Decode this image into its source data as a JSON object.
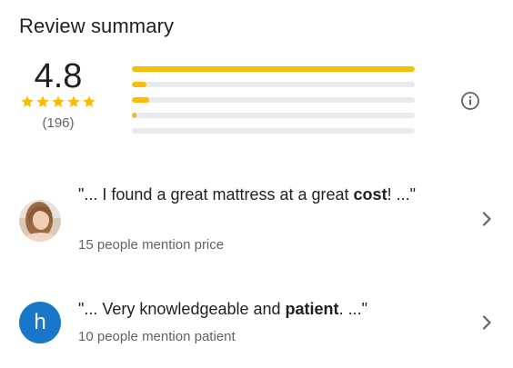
{
  "title": "Review summary",
  "rating": {
    "value": "4.8",
    "stars": 5,
    "count": "(196)"
  },
  "distribution": [
    {
      "stars": 5,
      "fraction": 1.0
    },
    {
      "stars": 4,
      "fraction": 0.05
    },
    {
      "stars": 3,
      "fraction": 0.06
    },
    {
      "stars": 2,
      "fraction": 0.015
    },
    {
      "stars": 1,
      "fraction": 0.0
    }
  ],
  "colors": {
    "accent": "#fbbc04",
    "track": "#e8eaed",
    "avatar_bg": "#1877c9",
    "text_primary": "#202124",
    "text_secondary": "#5f6368"
  },
  "icons": {
    "info": "info-icon",
    "chevron": "chevron-right-icon",
    "star": "star-icon"
  },
  "mentions": [
    {
      "quote_prefix": "\"... I found a great mattress at a great ",
      "quote_bold": "cost",
      "quote_suffix": "! ...\"",
      "subtitle": "15 people mention price"
    },
    {
      "avatar_letter": "h",
      "quote_prefix": "\"... Very knowledgeable and ",
      "quote_bold": "patient",
      "quote_suffix": ". ...\"",
      "subtitle": "10 people mention patient"
    }
  ]
}
